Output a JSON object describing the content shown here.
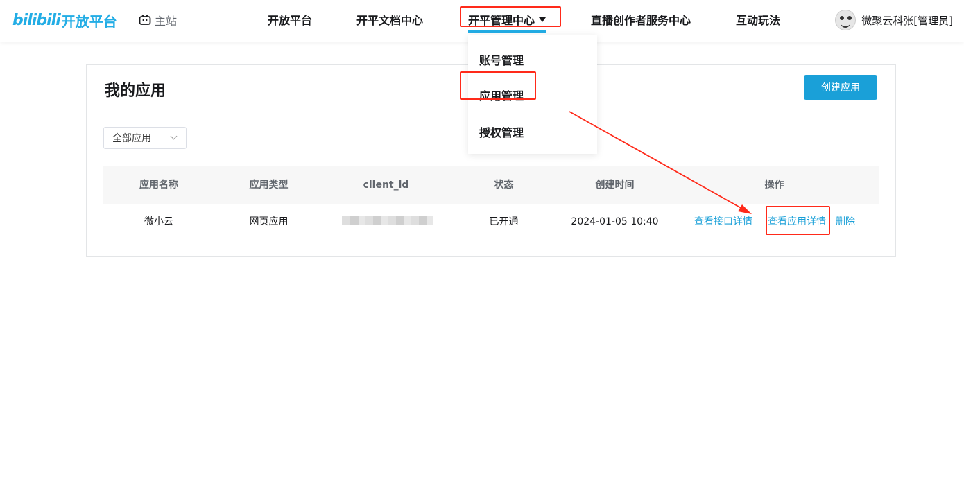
{
  "header": {
    "logo_bili": "bilibili",
    "logo_text": "开放平台",
    "home_link": "主站",
    "nav": [
      {
        "label": "开放平台"
      },
      {
        "label": "开平文档中心"
      },
      {
        "label": "开平管理中心"
      },
      {
        "label": "直播创作者服务中心"
      },
      {
        "label": "互动玩法"
      }
    ],
    "user_name": "微聚云科张[管理员]"
  },
  "dropdown": {
    "items": [
      "账号管理",
      "应用管理",
      "授权管理"
    ]
  },
  "card": {
    "title": "我的应用",
    "create_button": "创建应用",
    "filter_value": "全部应用"
  },
  "table": {
    "headers": [
      "应用名称",
      "应用类型",
      "client_id",
      "状态",
      "创建时间",
      "操作"
    ],
    "rows": [
      {
        "name": "微小云",
        "type": "网页应用",
        "status": "已开通",
        "created": "2024-01-05 10:40",
        "actions": [
          "查看接口详情",
          "查看应用详情",
          "删除"
        ]
      }
    ]
  },
  "colors": {
    "brand": "#23ade5",
    "button": "#1aa0d8",
    "annotation": "#ff2a1a"
  },
  "icons": [
    "tv-icon",
    "caret-down-icon",
    "chevron-down-icon",
    "avatar"
  ]
}
